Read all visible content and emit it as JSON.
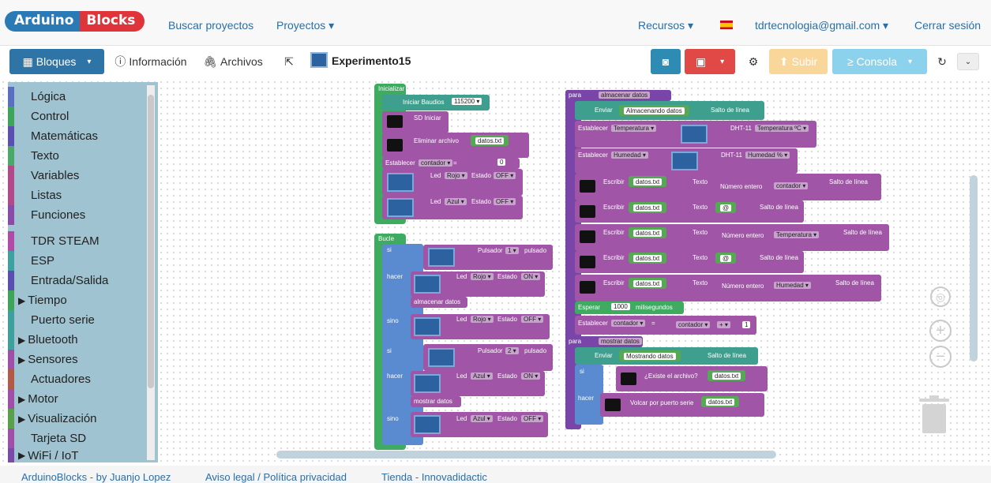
{
  "navbar": {
    "logo_left": "Arduino",
    "logo_right": "Blocks",
    "buscar": "Buscar proyectos",
    "proyectos": "Proyectos ▾",
    "recursos": "Recursos ▾",
    "user": "tdrtecnologia@gmail.com ▾",
    "logout": "Cerrar sesión",
    "flag_icon": "spain-flag-icon"
  },
  "toolbar": {
    "bloques": "Bloques",
    "informacion": "Información",
    "archivos": "Archivos",
    "project_name": "Experimento15",
    "subir": "Subir",
    "consola": "Consola"
  },
  "sidebar": {
    "categories": [
      {
        "label": "Lógica",
        "color": "#5a6fc0"
      },
      {
        "label": "Control",
        "color": "#3fa45b"
      },
      {
        "label": "Matemáticas",
        "color": "#5b4fb0"
      },
      {
        "label": "Texto",
        "color": "#4aa96a"
      },
      {
        "label": "Variables",
        "color": "#b24a8a"
      },
      {
        "label": "Listas",
        "color": "#b24a8a"
      },
      {
        "label": "Funciones",
        "color": "#8a4aa8"
      },
      {
        "label": "TDR STEAM",
        "color": "#b24aa8"
      },
      {
        "label": "ESP",
        "color": "#3fa0a0"
      },
      {
        "label": "Entrada/Salida",
        "color": "#5a4fb0"
      },
      {
        "label": "Tiempo",
        "color": "#3fa45b"
      },
      {
        "label": "Puerto serie",
        "color": "#3f9f9a"
      },
      {
        "label": "Bluetooth",
        "color": "#3f9f9a"
      },
      {
        "label": "Sensores",
        "color": "#a04fa8"
      },
      {
        "label": "Actuadores",
        "color": "#b05a4a"
      },
      {
        "label": "Motor",
        "color": "#a04fa8"
      },
      {
        "label": "Visualización",
        "color": "#5aa04a"
      },
      {
        "label": "Tarjeta SD",
        "color": "#a04fa8"
      },
      {
        "label": "WiFi / IoT",
        "color": "#7a4aa8"
      }
    ]
  },
  "blocks": {
    "inicializar": "Inicializar",
    "iniciar": "Iniciar  Baudios",
    "baud": "115200 ▾",
    "sd_iniciar": "SD Iniciar",
    "eliminar": "Eliminar archivo",
    "datos_txt": "datos.txt",
    "establecer": "Establecer",
    "contador": "contador ▾",
    "eq": "=",
    "zero": "0",
    "led": "Led",
    "rojo": "Rojo ▾",
    "azul": "Azul ▾",
    "estado": "Estado",
    "off": "OFF ▾",
    "on": "ON ▾",
    "bucle": "Bucle",
    "si": "si",
    "hacer": "hacer",
    "sino": "sino",
    "pulsador": "Pulsador",
    "p1": "1 ▾",
    "p2": "2 ▾",
    "pulsado": "pulsado",
    "almacenar_datos": "almacenar datos",
    "mostrar_datos": "mostrar datos",
    "para": "para",
    "enviar": "Enviar",
    "almacenando": "Almacenando datos",
    "mostrando": "Mostrando datos",
    "salto": "Salto de línea",
    "temperatura": "Temperatura ▾",
    "humedad": "Humedad ▾",
    "dht_temp": "DHT-11",
    "dht_temp_opt": "Temperatura ºC ▾",
    "dht_hum_opt": "Humedad % ▾",
    "escribir": "Escribir",
    "texto": "Texto",
    "numero_entero": "Número entero",
    "contador_v": "contador ▾",
    "temperatura_v": "Temperatura ▾",
    "humedad_v": "Humedad ▾",
    "sep": "@",
    "esperar": "Esperar",
    "ms": "1000",
    "milisegundos": "milisegundos",
    "plus": "+ ▾",
    "one": "1",
    "existe": "¿Existe el archivo?",
    "volcar": "Volcar por puerto serie"
  },
  "footer": {
    "credit": "ArduinoBlocks - by Juanjo Lopez",
    "legal": "Aviso legal / Política privacidad",
    "tienda": "Tienda - Innovadidactic"
  }
}
